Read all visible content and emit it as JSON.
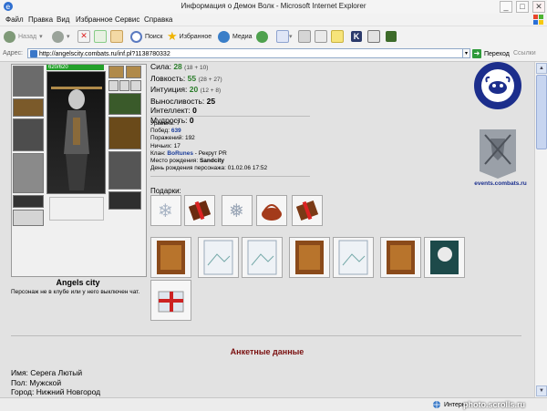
{
  "window": {
    "title": "Информация о Демон Волк - Microsoft Internet Explorer"
  },
  "menu": [
    "Файл",
    "Правка",
    "Вид",
    "Избранное",
    "Сервис",
    "Справка"
  ],
  "toolbar": {
    "back": "Назад",
    "search": "Поиск",
    "favorites": "Избранное",
    "media": "Медиа"
  },
  "address": {
    "label": "Адрес:",
    "url": "http://angelscity.combats.ru/inf.pl?1138780332",
    "go": "Переход",
    "links": "Ссылки"
  },
  "character": {
    "hp": "620/620",
    "name": "Angels city",
    "note": "Персонаж не в клубе или у него выключен чат."
  },
  "stats": [
    {
      "label": "Сила:",
      "value": "28",
      "extra": "(18 + 10)"
    },
    {
      "label": "Ловкость:",
      "value": "55",
      "extra": "(28 + 27)"
    },
    {
      "label": "Интуиция:",
      "value": "20",
      "extra": "(12 + 8)"
    },
    {
      "label": "Выносливость:",
      "value": "25",
      "extra": ""
    },
    {
      "label": "Интеллект:",
      "value": "0",
      "extra": ""
    },
    {
      "label": "Мудрость:",
      "value": "0",
      "extra": ""
    }
  ],
  "info": {
    "level_label": "Уровень:",
    "level": "7",
    "wins_label": "Побед:",
    "wins": "639",
    "losses_label": "Поражений:",
    "losses": "192",
    "draws_label": "Ничьих:",
    "draws": "17",
    "clan_label": "Клан:",
    "clan": "BoRunes",
    "clan_rank": " - Рекрут PR",
    "birthplace_label": "Место рождения:",
    "birthplace": "Sandcity",
    "birthday_label": "День рождения персонажа:",
    "birthday": "01.02.06 17:52"
  },
  "gifts_label": "Подарки:",
  "banner": {
    "link": "events.combats.ru"
  },
  "anketa": {
    "title": "Анкетные данные",
    "name_label": "Имя:",
    "name": "Серега Лютый",
    "gender_label": "Пол:",
    "gender": "Мужской",
    "city_label": "Город:",
    "city": "Нижний Новгород"
  },
  "status": {
    "zone": "Интерн",
    "watermark": "photo.scrolls.ru"
  },
  "colors": {
    "accent_blue": "#1c2e8c",
    "stat_green": "#2a7d2a",
    "anketa_red": "#7a1010",
    "hp_green": "#23a02a"
  }
}
